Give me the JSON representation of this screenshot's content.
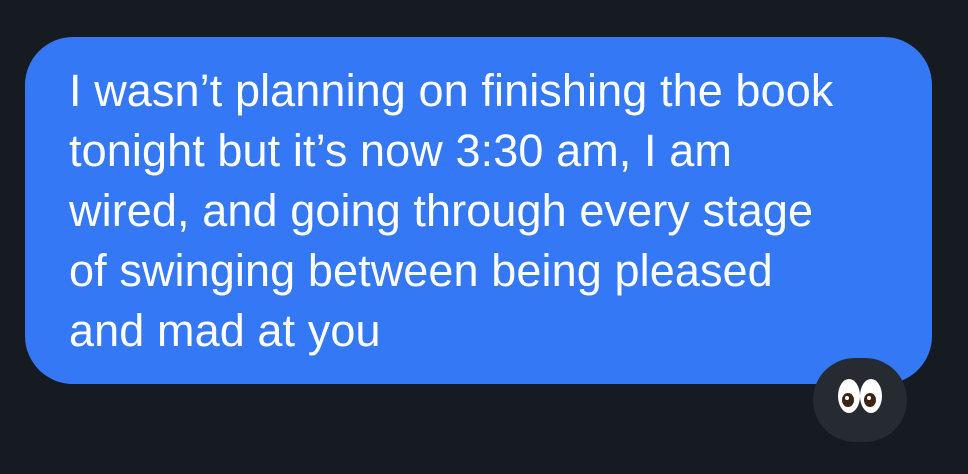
{
  "message": {
    "text": "I wasn’t planning on finishing the book\ntonight but it’s now 3:30 am, I am\nwired, and going through every stage\nof swinging between being pleased\nand mad at you",
    "bubble_color": "#3478f6",
    "text_color": "#ffffff"
  },
  "reaction": {
    "icon": "eyes-emoji-icon",
    "background_color": "#262a31"
  },
  "background_color": "#161b22"
}
